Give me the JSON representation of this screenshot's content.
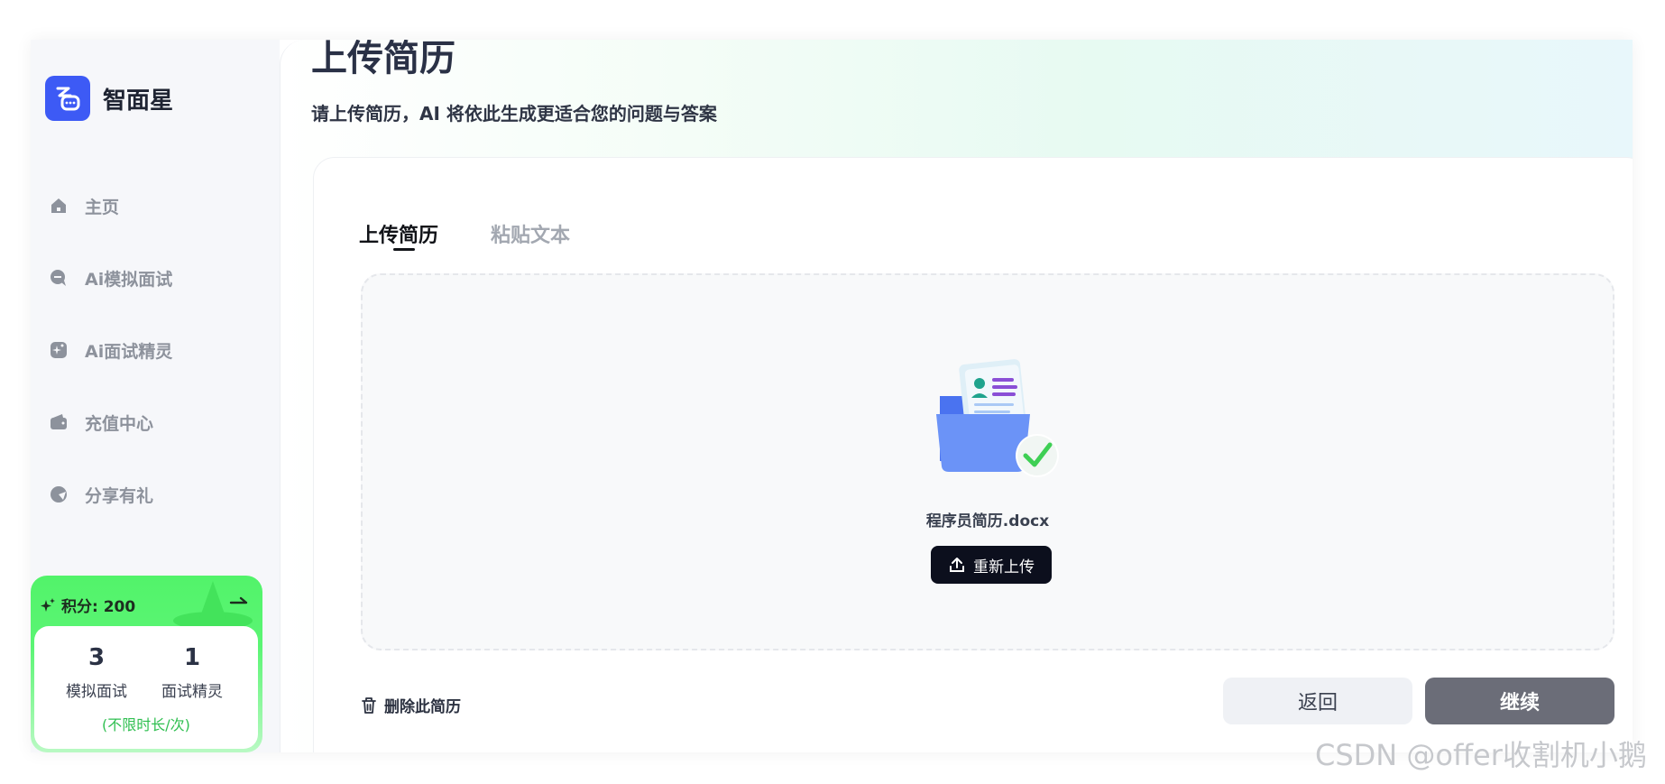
{
  "brand": {
    "name": "智面星",
    "icon": "speech-bubble-logo-icon",
    "accent": "#3d5af5"
  },
  "nav": [
    {
      "label": "主页",
      "icon": "home-icon"
    },
    {
      "label": "Ai模拟面试",
      "icon": "chat-bubble-icon"
    },
    {
      "label": "Ai面试精灵",
      "icon": "sparkle-icon"
    },
    {
      "label": "充值中心",
      "icon": "wallet-icon"
    },
    {
      "label": "分享有礼",
      "icon": "share-icon"
    }
  ],
  "points": {
    "label": "积分: 200",
    "stats": [
      {
        "value": "3",
        "label": "模拟面试"
      },
      {
        "value": "1",
        "label": "面试精灵"
      }
    ],
    "note": "(不限时长/次)"
  },
  "page": {
    "title": "上传简历",
    "subtitle": "请上传简历，AI 将依此生成更适合您的问题与答案"
  },
  "tabs": [
    {
      "label": "上传简历",
      "active": true
    },
    {
      "label": "粘贴文本",
      "active": false
    }
  ],
  "upload": {
    "file_name": "程序员简历.docx",
    "reupload_label": "重新上传"
  },
  "actions": {
    "delete_label": "删除此简历",
    "back_label": "返回",
    "next_label": "继续"
  },
  "watermark": "CSDN @offer收割机小鹅"
}
